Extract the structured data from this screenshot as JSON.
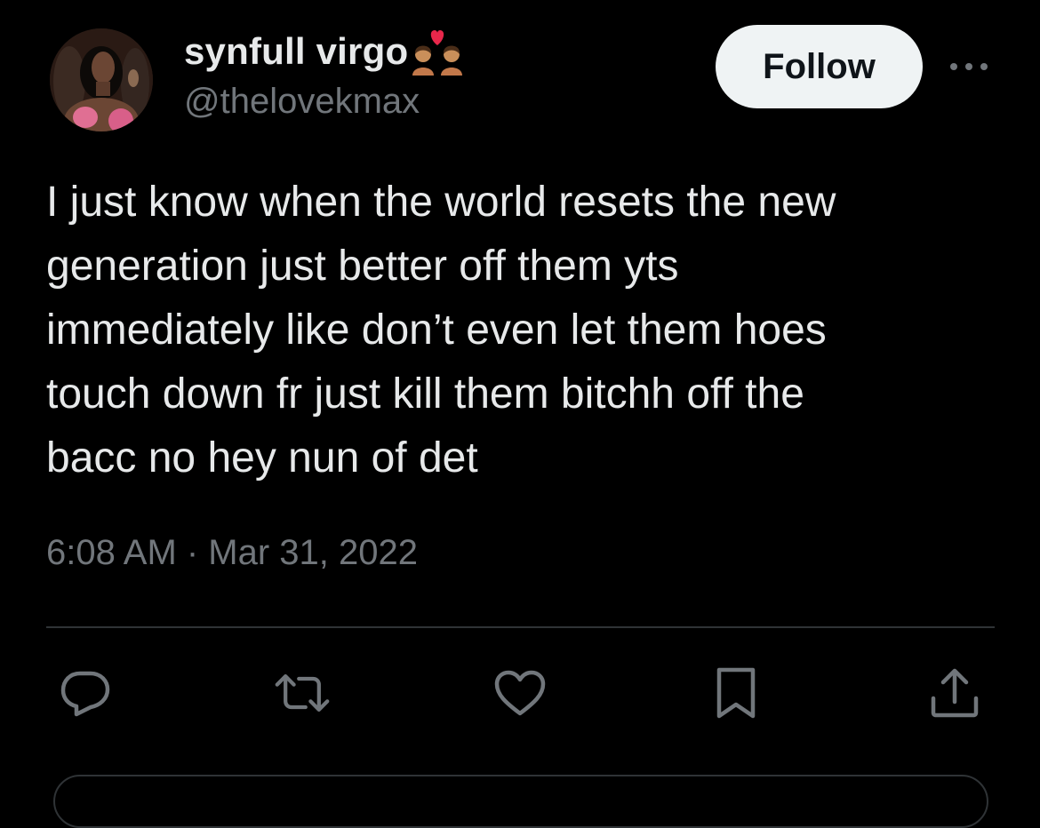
{
  "author": {
    "display_name": "synfull virgo",
    "name_emoji": "kiss-woman-woman-emoji",
    "handle": "@thelovekmax"
  },
  "header": {
    "follow_label": "Follow",
    "more_icon": "more-horizontal-icon"
  },
  "tweet": {
    "text_lines": [
      "I just know when the world resets the new",
      "generation just better off them yts",
      "immediately like don’t even let them hoes",
      "touch down fr just kill them bitchh off the",
      "bacc no hey nun of det"
    ],
    "timestamp": "6:08 AM · Mar 31, 2022"
  },
  "actions": [
    {
      "name": "reply",
      "icon": "reply-icon"
    },
    {
      "name": "retweet",
      "icon": "retweet-icon"
    },
    {
      "name": "like",
      "icon": "heart-icon"
    },
    {
      "name": "bookmark",
      "icon": "bookmark-icon"
    },
    {
      "name": "share",
      "icon": "share-icon"
    }
  ],
  "colors": {
    "background": "#000000",
    "text_primary": "#e7e9ea",
    "text_secondary": "#71767b",
    "divider": "#2f3336",
    "follow_button_bg": "#eff3f4",
    "follow_button_text": "#0f1419"
  }
}
